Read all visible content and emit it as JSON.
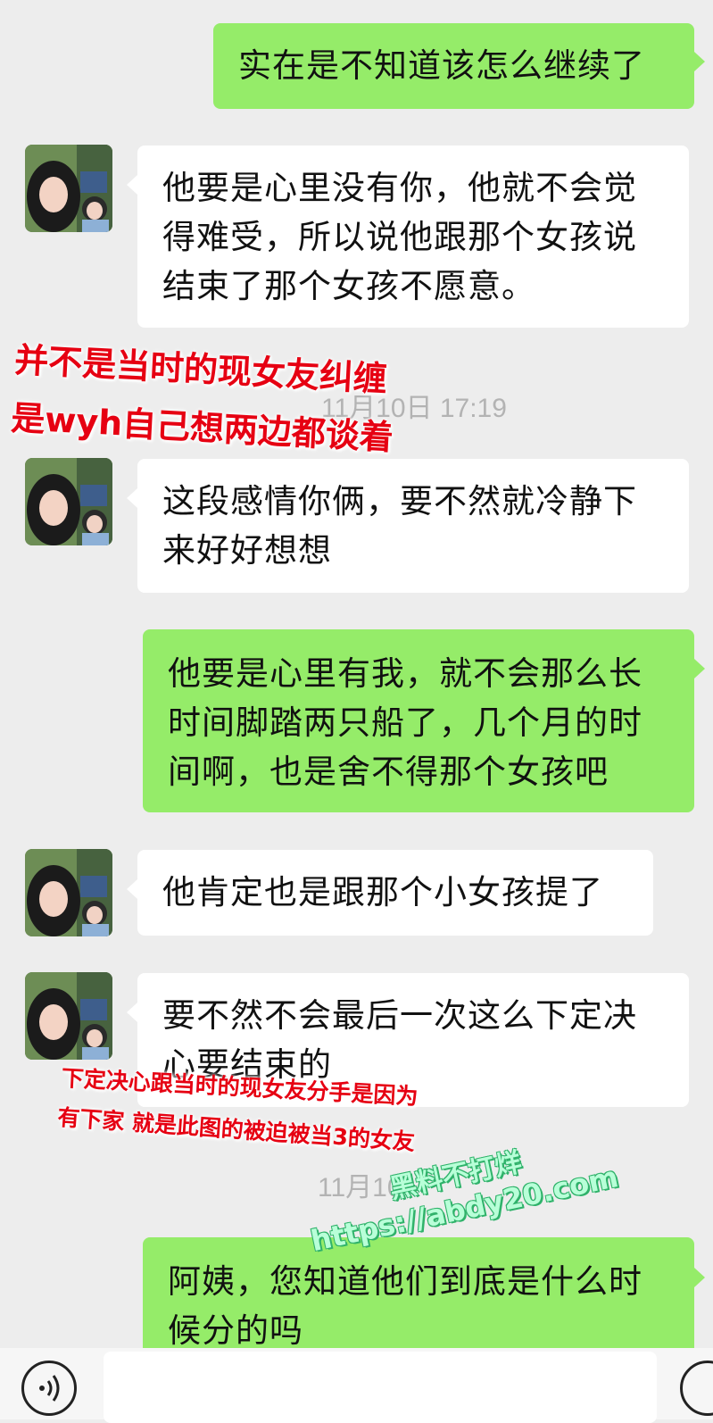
{
  "messages": [
    {
      "side": "out",
      "text": "实在是不知道该怎么继续了"
    },
    {
      "side": "in",
      "text": "他要是心里没有你，他就不会觉得难受，所以说他跟那个女孩说结束了那个女孩不愿意。"
    },
    {
      "side": "in",
      "text": "这段感情你俩，要不然就冷静下来好好想想"
    },
    {
      "side": "out",
      "text": "他要是心里有我，就不会那么长时间脚踏两只船了，几个月的时间啊，也是舍不得那个女孩吧"
    },
    {
      "side": "in",
      "text": "他肯定也是跟那个小女孩提了"
    },
    {
      "side": "in",
      "text": "要不然不会最后一次这么下定决心要结束的"
    },
    {
      "side": "out",
      "text": "阿姨，您知道他们到底是什么时候分的吗"
    }
  ],
  "timestamps": [
    "11月10日 17:19",
    "11月10"
  ],
  "annotations": [
    "并不是当时的现女友纠缠",
    "是wyh自己想两边都谈着",
    "下定决心跟当时的现女友分手是因为",
    "有下家 就是此图的被迫被当3的女友"
  ],
  "watermark": {
    "line1": "黑料不打烊",
    "line2": "https://abdy20.com"
  },
  "colors": {
    "background": "#ededed",
    "outgoing_bubble": "#95ec69",
    "incoming_bubble": "#ffffff",
    "annotation": "#e60012",
    "timestamp": "#b3b3b3"
  },
  "icons": {
    "voice": "voice-icon",
    "avatar": "contact-avatar"
  }
}
